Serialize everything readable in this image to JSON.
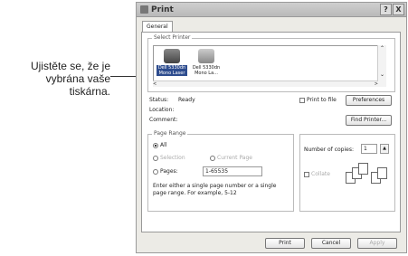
{
  "callout": "Ujistěte se, že je vybrána vaše tiskárna.",
  "dialog": {
    "title": "Print",
    "help": "?",
    "close": "X",
    "tab": "General"
  },
  "printer_group": {
    "label": "Select Printer",
    "printers": [
      {
        "name": "Dell 5330dn Mono Laser"
      },
      {
        "name": "Dell 5330dn Mono La..."
      }
    ],
    "scroll_up": "⌃",
    "scroll_down": "⌄",
    "h_left": "<",
    "h_right": ">"
  },
  "status": {
    "status_label": "Status:",
    "status_value": "Ready",
    "location_label": "Location:",
    "comment_label": "Comment:",
    "print_to_file": "Print to file",
    "preferences": "Preferences",
    "find_printer": "Find Printer..."
  },
  "page_range": {
    "label": "Page Range",
    "all": "All",
    "selection": "Selection",
    "current_page": "Current Page",
    "pages": "Pages:",
    "pages_value": "1-65535",
    "help": "Enter either a single page number or a single page range. For example, 5-12"
  },
  "copies": {
    "label": "Number of copies:",
    "value": "1",
    "collate": "Collate"
  },
  "buttons": {
    "print": "Print",
    "cancel": "Cancel",
    "apply": "Apply"
  }
}
